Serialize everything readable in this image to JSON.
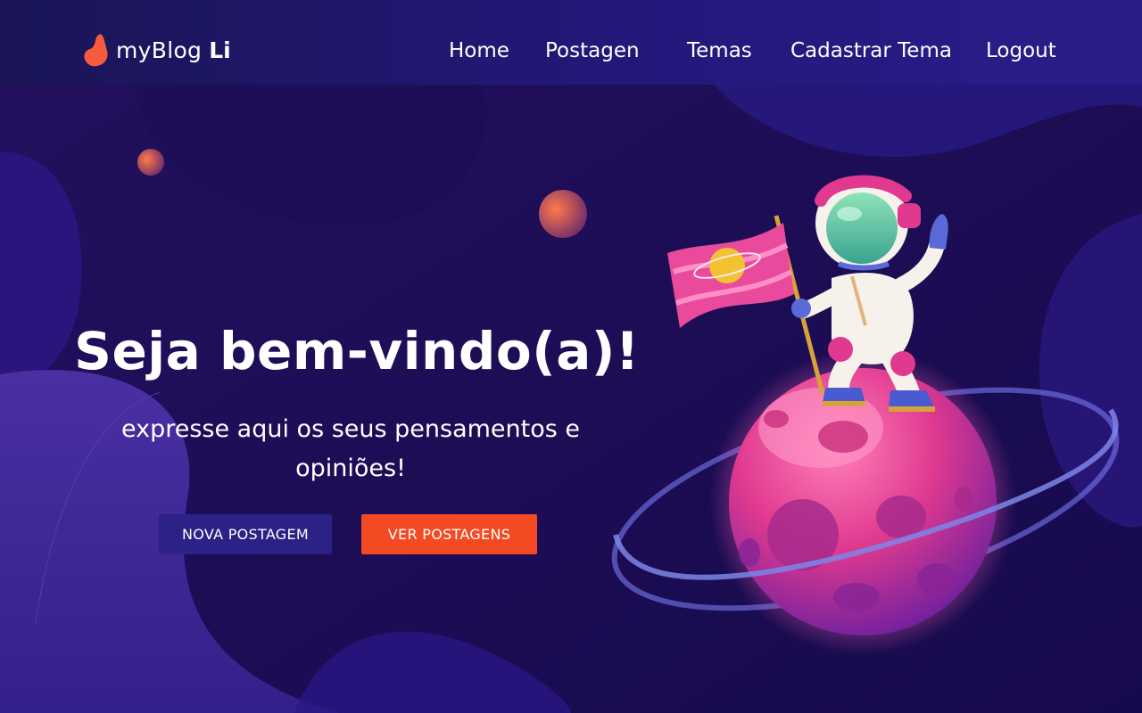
{
  "brand": {
    "name": "myBlog",
    "suffix": "Li",
    "icon": "flame-logo-icon"
  },
  "nav": {
    "items": [
      "Home",
      "Postagen",
      "Temas",
      "Cadastrar Tema",
      "Logout"
    ]
  },
  "hero": {
    "title": "Seja bem-vindo(a)!",
    "subtitle": "expresse aqui os seus pensamentos e opiniões!",
    "primary_button": "NOVA POSTAGEM",
    "accent_button": "VER POSTAGENS"
  },
  "colors": {
    "background": "#1e0f5c",
    "navbar": "#22187a",
    "primary_button": "#2b2186",
    "accent_button": "#f44a24",
    "planet": "#e0398f"
  }
}
